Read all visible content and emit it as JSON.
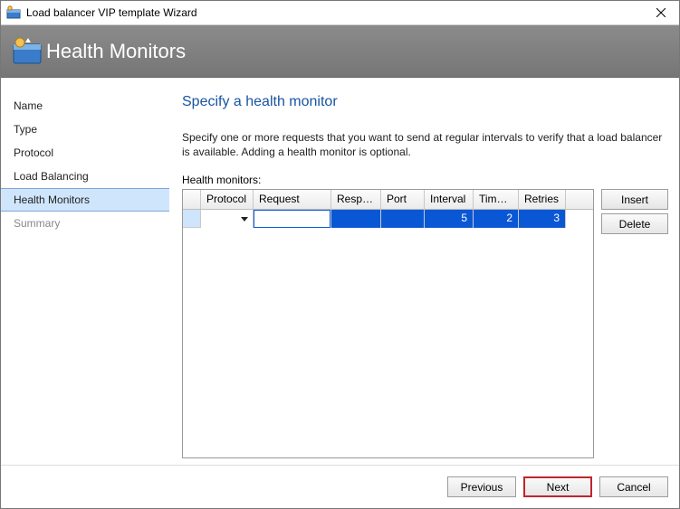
{
  "window": {
    "title": "Load balancer VIP template Wizard"
  },
  "banner": {
    "title": "Health Monitors"
  },
  "sidebar": {
    "items": [
      {
        "label": "Name"
      },
      {
        "label": "Type"
      },
      {
        "label": "Protocol"
      },
      {
        "label": "Load Balancing"
      },
      {
        "label": "Health Monitors"
      },
      {
        "label": "Summary"
      }
    ]
  },
  "page": {
    "heading": "Specify a health monitor",
    "description": "Specify one or more requests that you want to send at regular intervals to verify that a load balancer is available. Adding a health monitor is optional.",
    "grid_label": "Health monitors:"
  },
  "columns": {
    "protocol": "Protocol",
    "request": "Request",
    "response": "Respo...",
    "port": "Port",
    "interval": "Interval",
    "timeout": "Time-...",
    "retries": "Retries"
  },
  "row": {
    "protocol": "",
    "request": "",
    "response": "",
    "port": "",
    "interval": "5",
    "timeout": "2",
    "retries": "3"
  },
  "buttons": {
    "insert": "Insert",
    "delete": "Delete",
    "previous": "Previous",
    "next": "Next",
    "cancel": "Cancel"
  }
}
